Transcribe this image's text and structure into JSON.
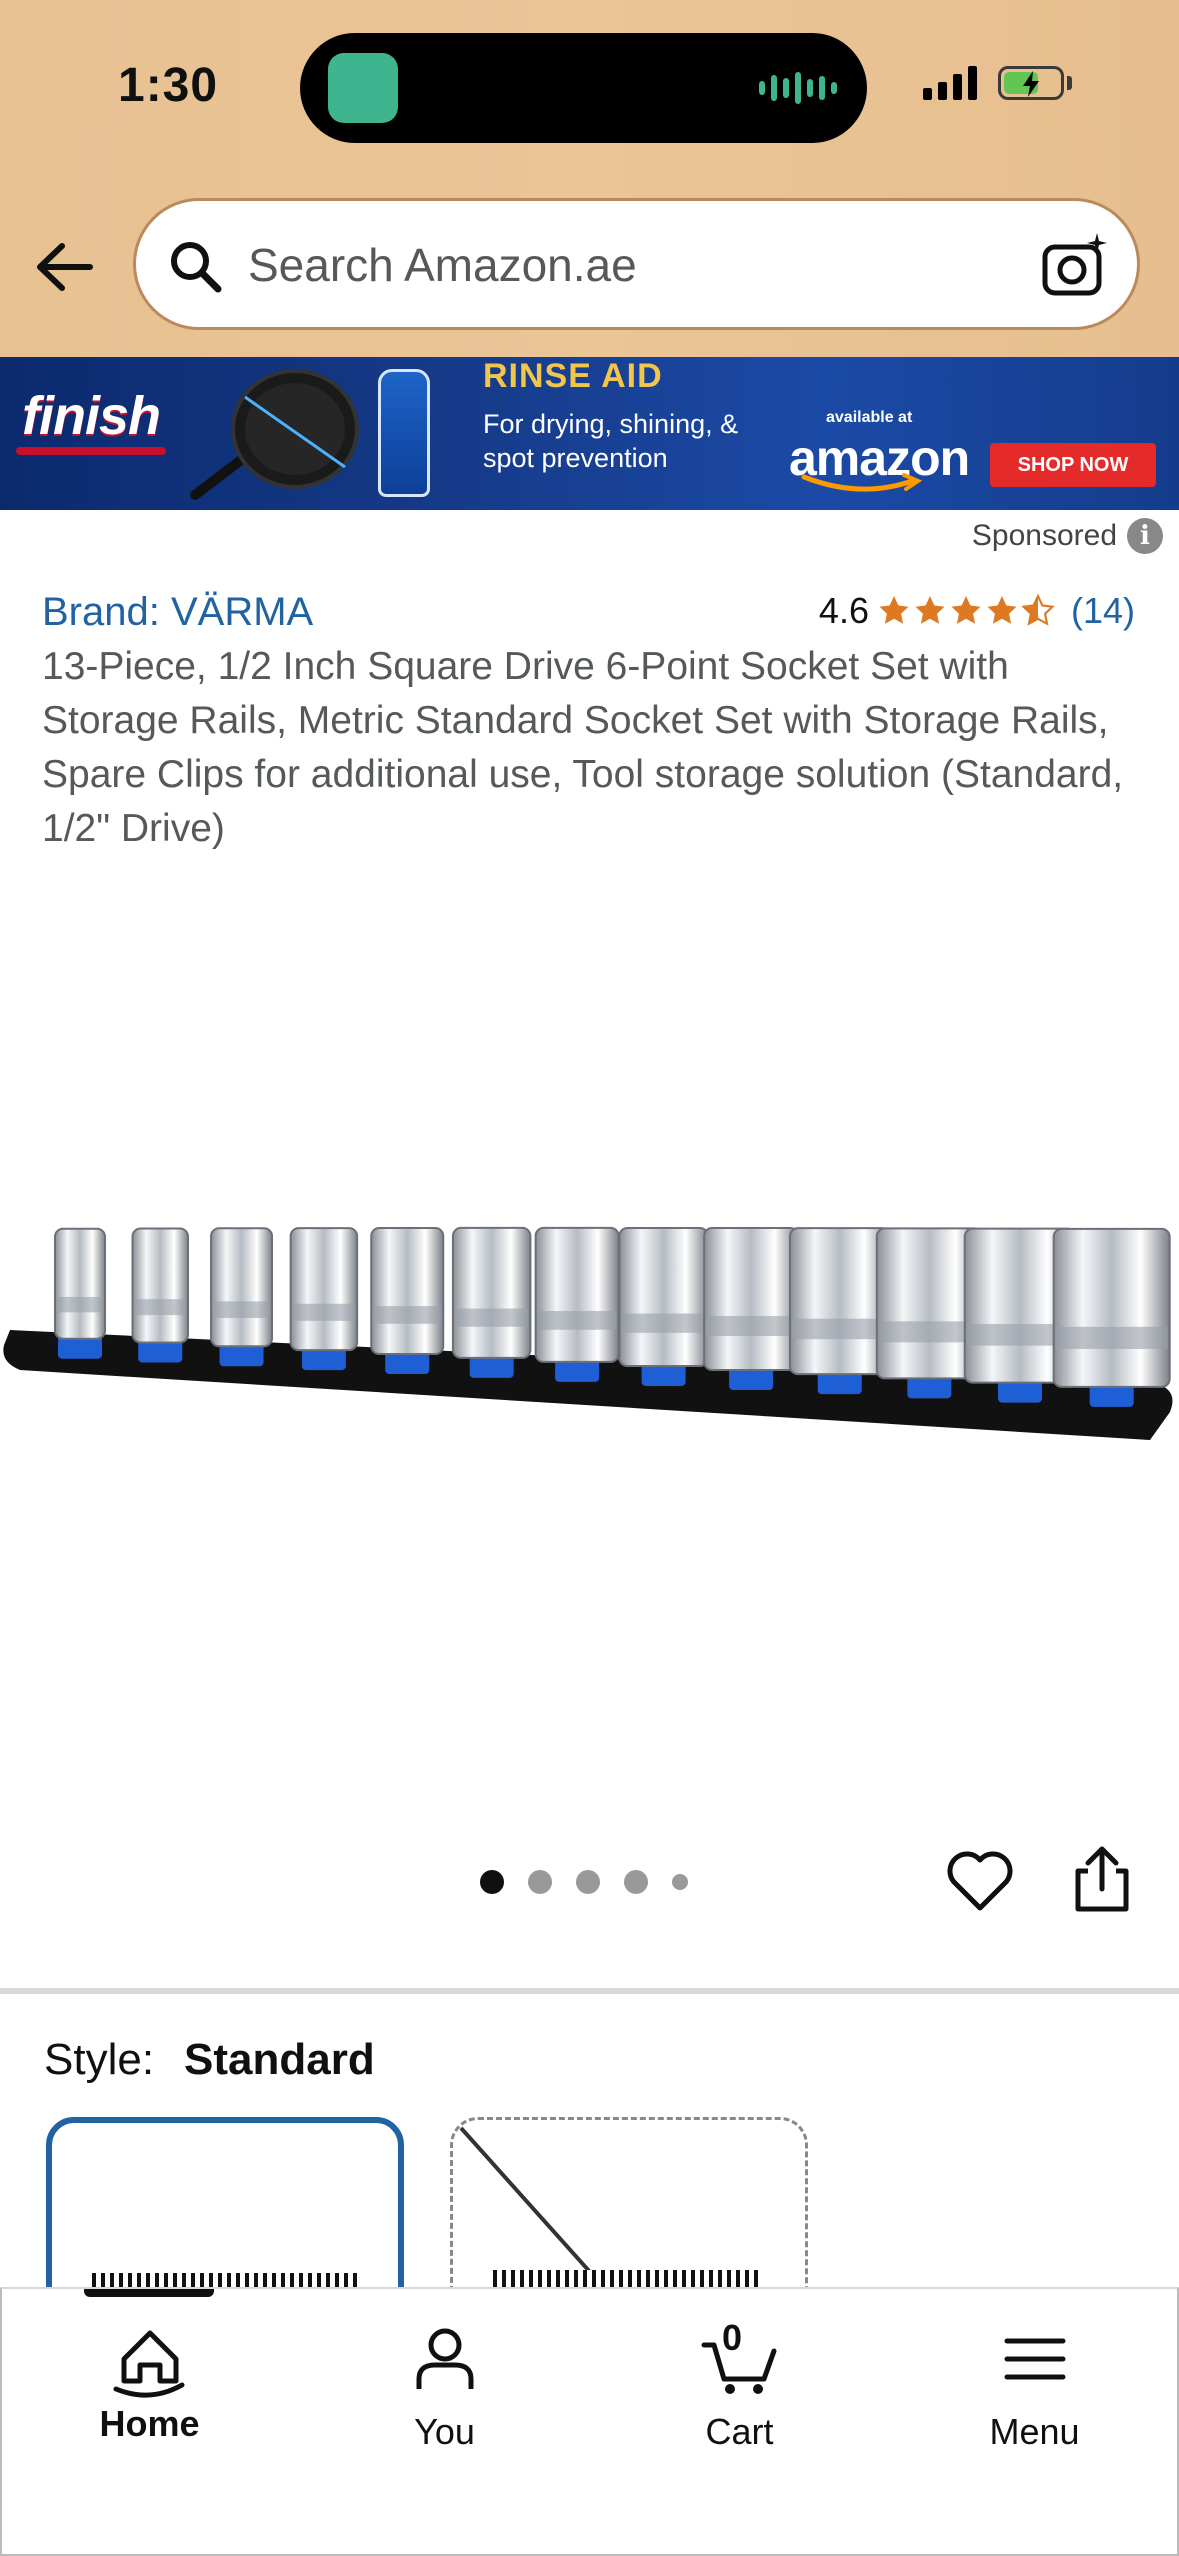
{
  "status_bar": {
    "time": "1:30"
  },
  "search": {
    "placeholder": "Search Amazon.ae"
  },
  "banner": {
    "brand": "finish",
    "headline": "RINSE AID",
    "subline": "For drying, shining, & spot prevention",
    "available": "available at",
    "retailer": "amazon",
    "cta": "SHOP NOW"
  },
  "sponsored_label": "Sponsored",
  "product": {
    "brand": "Brand: VÄRMA",
    "rating": "4.6",
    "stars": 4.5,
    "rating_count": "(14)",
    "title": "13-Piece, 1/2 Inch Square Drive 6-Point Socket Set with Storage Rails, Metric Standard Socket Set with Storage Rails, Spare Clips for additional use, Tool storage solution (Standard, 1/2\" Drive)",
    "image_count": 5,
    "active_image": 1
  },
  "style": {
    "label": "Style:",
    "value": "Standard"
  },
  "bottom_nav": {
    "home": "Home",
    "you": "You",
    "cart": "Cart",
    "cart_count": "0",
    "menu": "Menu"
  },
  "colors": {
    "header_bg": "#e8c193",
    "link": "#2162a1",
    "star": "#de7921",
    "banner_bg": "#163b8a",
    "cta_red": "#e52a2a"
  }
}
